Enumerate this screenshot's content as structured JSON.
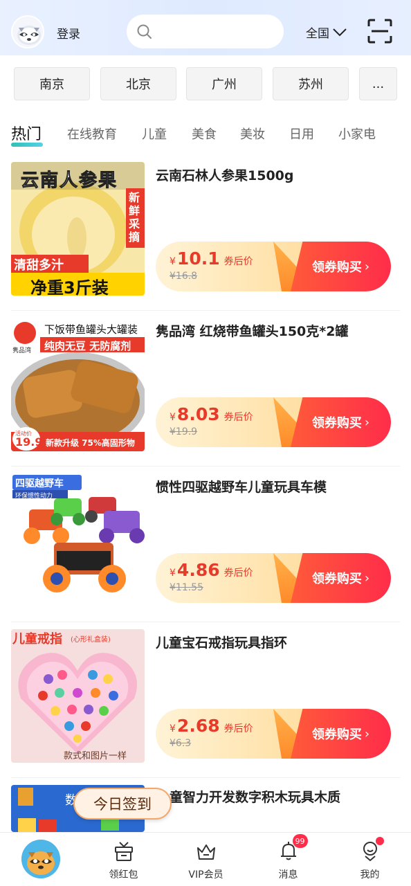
{
  "header": {
    "login_label": "登录",
    "search_placeholder": "",
    "region_label": "全国",
    "icons": {
      "avatar": "raccoon-avatar",
      "search": "search-icon",
      "region": "chevron-down-icon",
      "scan": "scan-icon"
    }
  },
  "cities": [
    {
      "label": "南京"
    },
    {
      "label": "北京"
    },
    {
      "label": "广州"
    },
    {
      "label": "苏州"
    },
    {
      "label": "..."
    }
  ],
  "tabs": [
    {
      "label": "热门",
      "active": true
    },
    {
      "label": "在线教育"
    },
    {
      "label": "儿童"
    },
    {
      "label": "美食"
    },
    {
      "label": "美妆"
    },
    {
      "label": "日用"
    },
    {
      "label": "小家电"
    }
  ],
  "products": [
    {
      "title": "云南石林人参果1500g",
      "price": "10.1",
      "original_price": "¥16.8",
      "image_text": {
        "top": "云南人参果",
        "side": "新鲜采摘",
        "badge": "清甜多汁",
        "bottom": "净重3斤装"
      }
    },
    {
      "title": "隽品湾 红烧带鱼罐头150克*2罐",
      "price": "8.03",
      "original_price": "¥19.9",
      "image_text": {
        "top": "下饭带鱼罐头大罐装",
        "mid": "纯肉无豆 无防腐剂",
        "price_tag": "19.9",
        "tag_label": "活动价",
        "bottom": "新款升级 75%高固形物",
        "brand": "隽品湾"
      }
    },
    {
      "title": "惯性四驱越野车儿童玩具车模",
      "price": "4.86",
      "original_price": "¥11.55",
      "image_text": {
        "top": "四驱越野车",
        "sub": "环保惯性动力"
      }
    },
    {
      "title": "儿童宝石戒指玩具指环",
      "price": "2.68",
      "original_price": "¥6.3",
      "image_text": {
        "top": "儿童戒指",
        "sub": "(心形礼盒装)",
        "bottom": "款式和图片一样"
      }
    },
    {
      "title": "童智力开发数字积木玩具木质",
      "image_text": {
        "top": "数"
      }
    }
  ],
  "price_suffix": "券后价",
  "currency": "¥",
  "buy_label": "领券购买",
  "checkin_label": "今日签到",
  "bottom_nav": [
    {
      "label": "",
      "icon": "home-avatar"
    },
    {
      "label": "领红包",
      "icon": "gift-icon"
    },
    {
      "label": "VIP会员",
      "icon": "crown-icon"
    },
    {
      "label": "消息",
      "icon": "bell-icon",
      "badge": "99"
    },
    {
      "label": "我的",
      "icon": "user-icon",
      "dot": true
    }
  ],
  "colors": {
    "accent_red": "#ff2d4a",
    "price_red": "#e83a2a",
    "tab_underline": "#2ec2b6",
    "header_bg": "#e3edff"
  }
}
